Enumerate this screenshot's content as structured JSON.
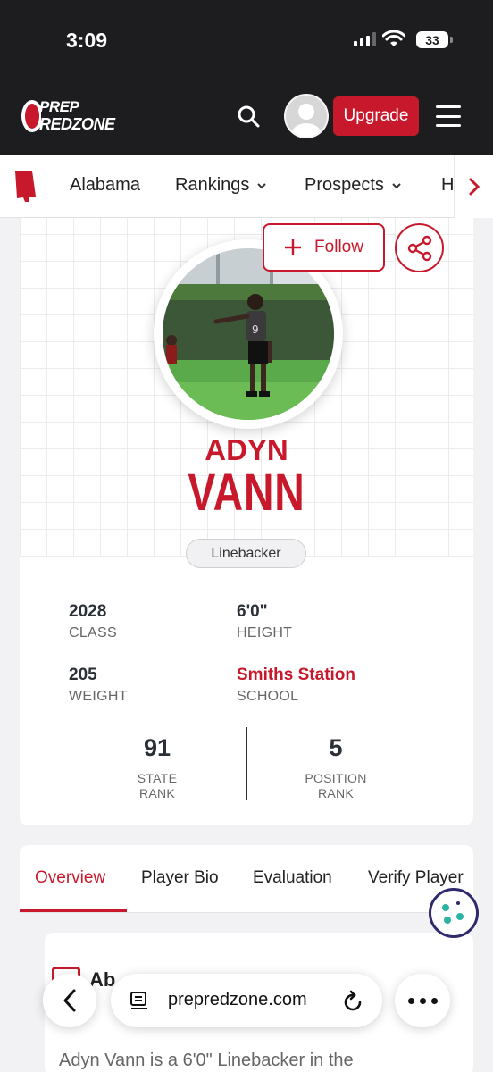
{
  "status_bar": {
    "time": "3:09",
    "battery": "33"
  },
  "header": {
    "logo_line1": "PREP",
    "logo_line2": "REDZONE",
    "upgrade_label": "Upgrade"
  },
  "nav": {
    "items": [
      {
        "label": "Alabama"
      },
      {
        "label": "Rankings"
      },
      {
        "label": "Prospects"
      },
      {
        "label": "H"
      }
    ]
  },
  "profile": {
    "follow_label": "Follow",
    "first_name": "ADYN",
    "last_name": "VANN",
    "position": "Linebacker",
    "jersey_number": "9",
    "stats": [
      {
        "value": "2028",
        "label": "CLASS"
      },
      {
        "value": "6'0\"",
        "label": "HEIGHT"
      },
      {
        "value": "205",
        "label": "WEIGHT"
      },
      {
        "value": "Smiths Station",
        "label": "SCHOOL",
        "highlight": true
      }
    ],
    "ranks": [
      {
        "value": "91",
        "label_line1": "STATE",
        "label_line2": "RANK"
      },
      {
        "value": "5",
        "label_line1": "POSITION",
        "label_line2": "RANK"
      }
    ]
  },
  "tabs": [
    {
      "label": "Overview",
      "active": true
    },
    {
      "label": "Player Bio"
    },
    {
      "label": "Evaluation"
    },
    {
      "label": "Verify Player"
    }
  ],
  "about": {
    "title": "Ab",
    "text": "Adyn Vann is a 6'0\" Linebacker in the"
  },
  "browser": {
    "url": "prepredzone.com"
  },
  "colors": {
    "brand_red": "#c8192c",
    "header_bg": "#1d1d1f",
    "cookie_accent": "#2f2a6b"
  },
  "icons": [
    "search-icon",
    "menu-icon",
    "chevron-down-icon",
    "chevron-right-icon",
    "plus-icon",
    "share-icon",
    "cookie-icon",
    "back-icon",
    "tabs-icon",
    "reload-icon",
    "more-icon"
  ]
}
